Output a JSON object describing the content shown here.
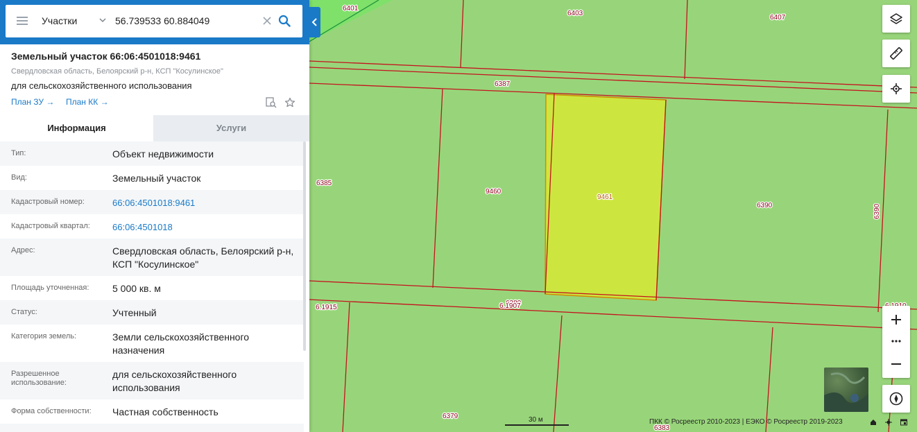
{
  "search": {
    "category": "Участки",
    "query": "56.739533 60.884049"
  },
  "object": {
    "title": "Земельный участок 66:06:4501018:9461",
    "address": "Свердловская область, Белоярский р-н, КСП \"Косулинское\"",
    "usage": "для сельскохозяйственного использования",
    "plan_zu": "План ЗУ →",
    "plan_kk": "План КК →"
  },
  "tabs": {
    "info": "Информация",
    "services": "Услуги"
  },
  "rows": [
    {
      "key": "Тип:",
      "value": "Объект недвижимости"
    },
    {
      "key": "Вид:",
      "value": "Земельный участок"
    },
    {
      "key": "Кадастровый номер:",
      "value": "66:06:4501018:9461"
    },
    {
      "key": "Кадастровый квартал:",
      "value": "66:06:4501018"
    },
    {
      "key": "Адрес:",
      "value": "Свердловская область, Белоярский р-н, КСП \"Косулинское\""
    },
    {
      "key": "Площадь уточненная:",
      "value": "5 000 кв. м"
    },
    {
      "key": "Статус:",
      "value": "Учтенный"
    },
    {
      "key": "Категория земель:",
      "value": "Земли сельскохозяйственного назначения"
    },
    {
      "key": "Разрешенное использование:",
      "value": "для сельскохозяйственного использования"
    },
    {
      "key": "Форма собственности:",
      "value": "Частная собственность"
    }
  ],
  "map": {
    "parcel_labels": [
      "6401",
      "6403",
      "6407",
      "6387",
      "6385",
      "9460",
      "9461",
      "6390",
      "6390",
      "6380",
      "6.1915",
      "6.1907",
      "6.1910",
      "6379",
      "6383"
    ],
    "scale_label": "30 м",
    "attribution": "ПКК © Росреестр 2010-2023 | ЕЭКО © Росреестр 2019-2023",
    "colors": {
      "map_bg": "#98d57a",
      "boundary": "#c4121e",
      "selected_fill": "#cde63f",
      "accent": "#1a7ac8"
    }
  }
}
